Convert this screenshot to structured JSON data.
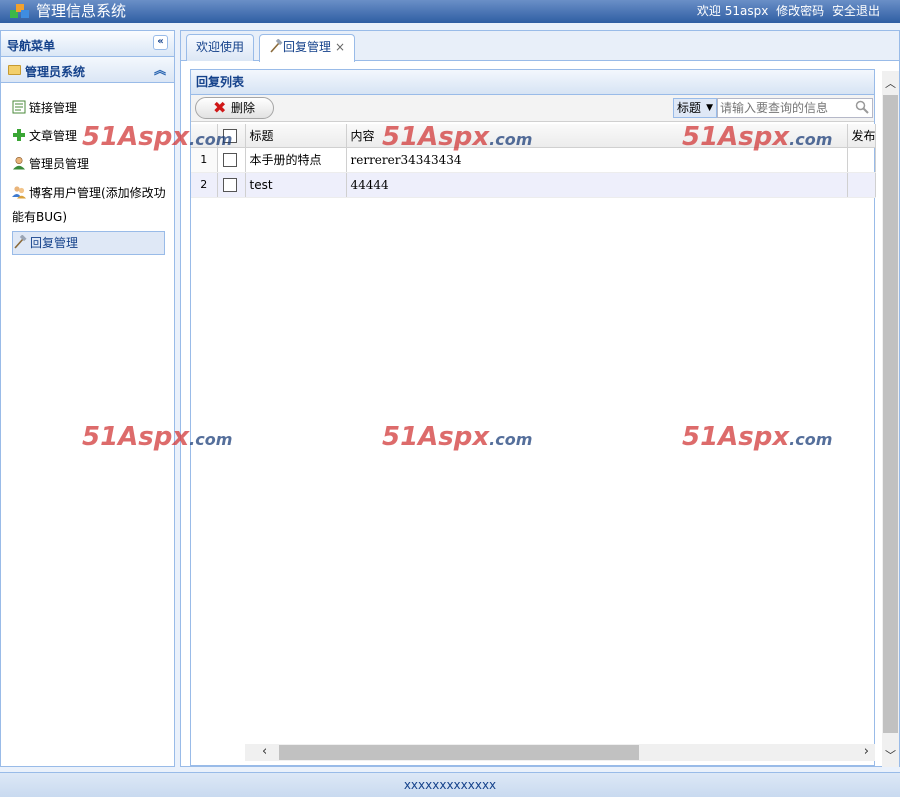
{
  "header": {
    "title": "管理信息系统",
    "welcome": "欢迎 51aspx",
    "change_password": "修改密码",
    "logout": "安全退出"
  },
  "sidebar": {
    "title": "导航菜单",
    "collapse_icon": "double-chevron-left-icon",
    "group_title": "管理员系统",
    "group_toggle_icon": "double-chevron-up-icon",
    "items": [
      {
        "label": "链接管理",
        "icon": "document-icon"
      },
      {
        "label": "文章管理",
        "icon": "add-icon"
      },
      {
        "label": "管理员管理",
        "icon": "user-icon"
      },
      {
        "label": "博客用户管理(添加修改功能有BUG)",
        "icon": "users-icon"
      },
      {
        "label": "回复管理",
        "icon": "hammer-icon"
      }
    ]
  },
  "tabs": [
    {
      "label": "欢迎使用"
    },
    {
      "label": "回复管理",
      "close": "×"
    }
  ],
  "grid": {
    "title": "回复列表",
    "delete_label": "删除",
    "search_field": "标题",
    "search_placeholder": "请输入要查询的信息",
    "columns": [
      "标题",
      "内容",
      "发布"
    ],
    "rows": [
      {
        "num": "1",
        "title": "本手册的特点",
        "content": "rerrerer34343434"
      },
      {
        "num": "2",
        "title": "test",
        "content": "44444"
      }
    ]
  },
  "watermark": {
    "text": "51Aspx",
    "suffix": ".com"
  },
  "footer": {
    "text": "xxxxxxxxxxxxx"
  },
  "colors": {
    "header": "#2f5ea3",
    "accent": "#15428b",
    "border": "#99bbe8"
  }
}
